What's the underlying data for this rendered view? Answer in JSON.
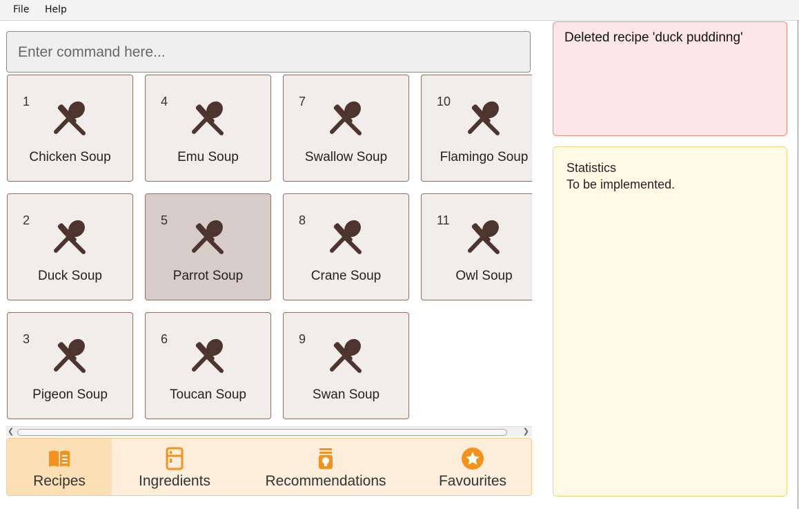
{
  "menu": {
    "file": "File",
    "help": "Help"
  },
  "command": {
    "placeholder": "Enter command here...",
    "value": ""
  },
  "recipes": [
    {
      "index": "1",
      "name": "Chicken Soup",
      "selected": false
    },
    {
      "index": "2",
      "name": "Duck Soup",
      "selected": false
    },
    {
      "index": "3",
      "name": "Pigeon Soup",
      "selected": false
    },
    {
      "index": "4",
      "name": "Emu Soup",
      "selected": false
    },
    {
      "index": "5",
      "name": "Parrot Soup",
      "selected": true
    },
    {
      "index": "6",
      "name": "Toucan Soup",
      "selected": false
    },
    {
      "index": "7",
      "name": "Swallow Soup",
      "selected": false
    },
    {
      "index": "8",
      "name": "Crane Soup",
      "selected": false
    },
    {
      "index": "9",
      "name": "Swan Soup",
      "selected": false
    },
    {
      "index": "10",
      "name": "Flamingo Soup",
      "selected": false
    },
    {
      "index": "11",
      "name": "Owl Soup",
      "selected": false
    }
  ],
  "recipe_icon": "fork-spoon-icon",
  "tabs": [
    {
      "label": "Recipes",
      "icon": "open-book-icon",
      "active": true
    },
    {
      "label": "Ingredients",
      "icon": "fridge-icon",
      "active": false
    },
    {
      "label": "Recommendations",
      "icon": "lightbulb-icon",
      "active": false
    },
    {
      "label": "Favourites",
      "icon": "star-badge-icon",
      "active": false
    }
  ],
  "result_message": "Deleted recipe 'duck puddinng'",
  "statistics": {
    "title": "Statistics",
    "body": "To be implemented."
  },
  "colors": {
    "icon_brown": "#4e342e",
    "tab_orange": "#f5921e",
    "card_bg": "#f1edeb",
    "card_selected": "#d8ccc9"
  }
}
